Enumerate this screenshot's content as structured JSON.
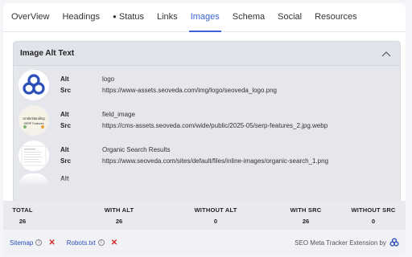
{
  "tabs": [
    {
      "label": "OverView",
      "active": false
    },
    {
      "label": "Headings",
      "active": false
    },
    {
      "label": "Status",
      "active": false,
      "dot": "●"
    },
    {
      "label": "Links",
      "active": false
    },
    {
      "label": "Images",
      "active": true
    },
    {
      "label": "Schema",
      "active": false
    },
    {
      "label": "Social",
      "active": false
    },
    {
      "label": "Resources",
      "active": false
    }
  ],
  "images_section": {
    "title": "Image Alt Text",
    "alt_label": "Alt",
    "src_label": "Src",
    "items": [
      {
        "alt": "logo",
        "src": "https://www-assets.seoveda.com/img/logo/seoveda_logo.png",
        "thumb": "seoveda-logo-icon"
      },
      {
        "alt": "field_image",
        "src": "https://cms-assets.seoveda.com/wide/public/2025-05/serp-features_2.jpg.webp",
        "thumb_text": "Understanding SERP Features"
      },
      {
        "alt": "Organic Search Results",
        "src": "https://www.seoveda.com/sites/default/files/inline-images/organic-search_1.png",
        "thumb": "search-results-thumbnail"
      }
    ]
  },
  "stats": [
    {
      "label": "TOTAL",
      "value": "26"
    },
    {
      "label": "WITH ALT",
      "value": "26"
    },
    {
      "label": "WITHOUT ALT",
      "value": "0"
    },
    {
      "label": "WITH SRC",
      "value": "26"
    },
    {
      "label": "WITHOUT SRC",
      "value": "0"
    }
  ],
  "footer": {
    "sitemap": "Sitemap",
    "robots": "Robots.txt",
    "info_glyph": "i",
    "x_glyph": "✕",
    "brand_text": "SEO Meta Tracker Extension by"
  },
  "colors": {
    "accent": "#3b63d6",
    "error": "#d32b2b",
    "logo_blue": "#2d4fb8"
  }
}
